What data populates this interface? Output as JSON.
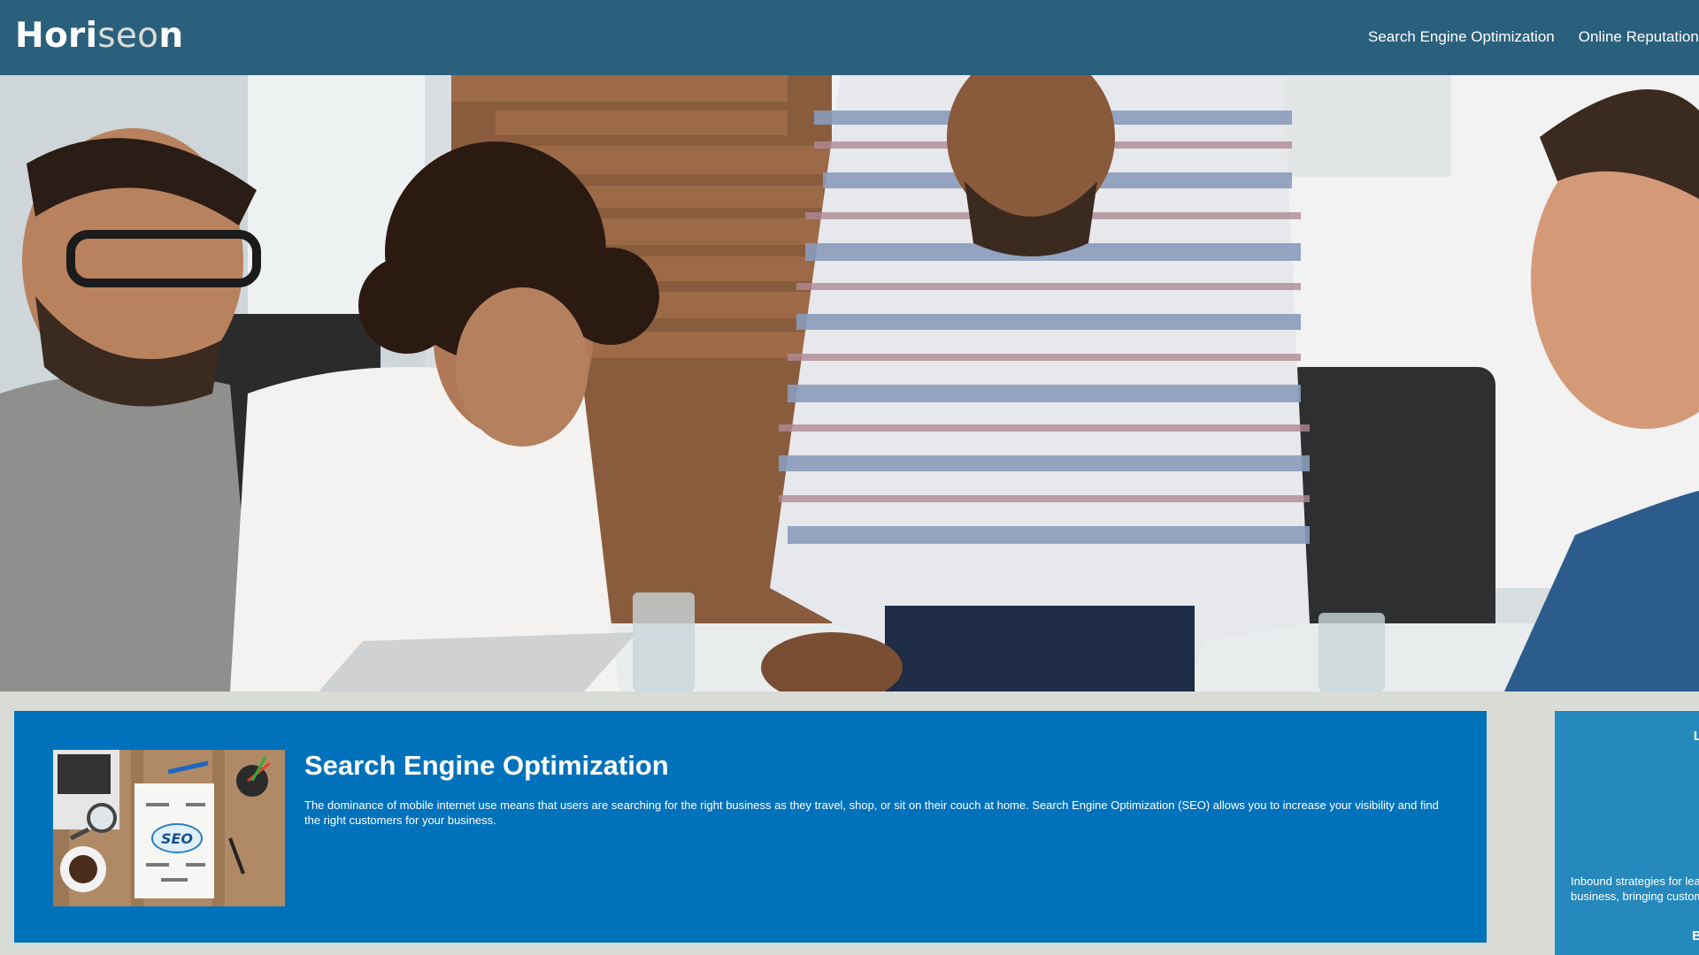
{
  "header": {
    "brand_main": "Hori",
    "brand_accent": "seo",
    "brand_end": "n",
    "nav": [
      "Search Engine Optimization",
      "Online Reputation Ma"
    ]
  },
  "hero": {
    "icon": "team-meeting-photo"
  },
  "card": {
    "title": "Search Engine Optimization",
    "text": "The dominance of mobile internet use means that users are searching for the right business as they travel, shop, or sit on their couch at home. Search Engine Optimization (SEO) allows you to increase your visibility and find the right customers for your business.",
    "image_icon": "seo-notebook-image",
    "image_label": "SEO"
  },
  "side": {
    "top_char": "L",
    "text_line1": "Inbound strategies for lea",
    "text_line2": "business, bringing custome",
    "bottom_char": "B"
  },
  "colors": {
    "header": "#2a607c",
    "card": "#0072bb",
    "side": "#2589bd",
    "page": "#d9dcd6"
  }
}
